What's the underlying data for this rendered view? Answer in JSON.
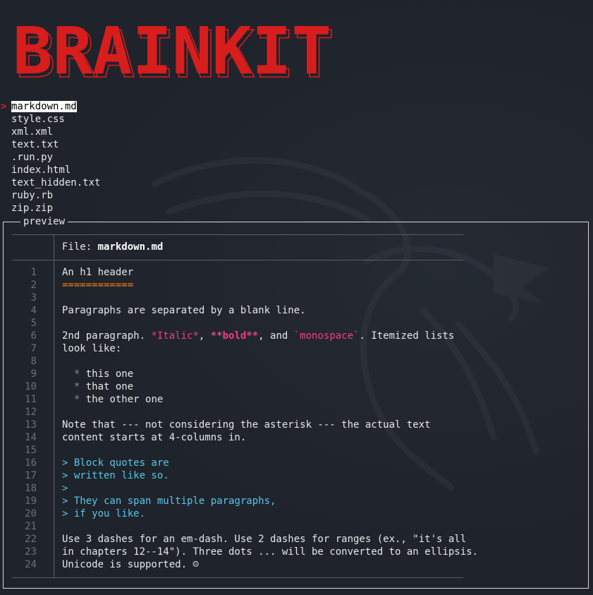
{
  "logo": {
    "text": "BRAINKIT",
    "color": "#d81d1d"
  },
  "files": {
    "pointer": ">",
    "items": [
      {
        "name": "markdown.md",
        "selected": true
      },
      {
        "name": "style.css"
      },
      {
        "name": "xml.xml"
      },
      {
        "name": "text.txt"
      },
      {
        "name": ".run.py"
      },
      {
        "name": "index.html"
      },
      {
        "name": "text_hidden.txt"
      },
      {
        "name": "ruby.rb"
      },
      {
        "name": "zip.zip"
      }
    ]
  },
  "preview": {
    "title": "preview",
    "file_label": "File:",
    "file_name": "markdown.md",
    "lines": [
      {
        "n": "1",
        "segs": [
          {
            "t": "An h1 header"
          }
        ]
      },
      {
        "n": "2",
        "segs": [
          {
            "t": "============",
            "c": "orange"
          }
        ]
      },
      {
        "n": "3",
        "segs": []
      },
      {
        "n": "4",
        "segs": [
          {
            "t": "Paragraphs are separated by a blank line."
          }
        ]
      },
      {
        "n": "5",
        "segs": []
      },
      {
        "n": "6",
        "segs": [
          {
            "t": "2nd paragraph. "
          },
          {
            "t": "*Italic*",
            "c": "pink"
          },
          {
            "t": ", "
          },
          {
            "t": "**bold**",
            "c": "pink bold"
          },
          {
            "t": ", and "
          },
          {
            "t": "`monospace`",
            "c": "pink"
          },
          {
            "t": ". Itemized lists"
          }
        ]
      },
      {
        "n": "7",
        "segs": [
          {
            "t": "look like:"
          }
        ]
      },
      {
        "n": "8",
        "segs": []
      },
      {
        "n": "9",
        "segs": [
          {
            "t": "  "
          },
          {
            "t": "*",
            "c": "grey"
          },
          {
            "t": " this one"
          }
        ]
      },
      {
        "n": "10",
        "segs": [
          {
            "t": "  "
          },
          {
            "t": "*",
            "c": "grey"
          },
          {
            "t": " that one"
          }
        ]
      },
      {
        "n": "11",
        "segs": [
          {
            "t": "  "
          },
          {
            "t": "*",
            "c": "grey"
          },
          {
            "t": " the other one"
          }
        ]
      },
      {
        "n": "12",
        "segs": []
      },
      {
        "n": "13",
        "segs": [
          {
            "t": "Note that --- not considering the asterisk --- the actual text"
          }
        ]
      },
      {
        "n": "14",
        "segs": [
          {
            "t": "content starts at 4-columns in."
          }
        ]
      },
      {
        "n": "15",
        "segs": []
      },
      {
        "n": "16",
        "segs": [
          {
            "t": "> Block quotes are",
            "c": "cyan"
          }
        ]
      },
      {
        "n": "17",
        "segs": [
          {
            "t": "> written like so.",
            "c": "cyan"
          }
        ]
      },
      {
        "n": "18",
        "segs": [
          {
            "t": ">",
            "c": "cyan"
          }
        ]
      },
      {
        "n": "19",
        "segs": [
          {
            "t": "> They can span multiple paragraphs,",
            "c": "cyan"
          }
        ]
      },
      {
        "n": "20",
        "segs": [
          {
            "t": "> if you like.",
            "c": "cyan"
          }
        ]
      },
      {
        "n": "21",
        "segs": []
      },
      {
        "n": "22",
        "segs": [
          {
            "t": "Use 3 dashes for an em-dash. Use 2 dashes for ranges (ex., \"it's all"
          }
        ]
      },
      {
        "n": "23",
        "segs": [
          {
            "t": "in chapters 12--14\"). Three dots ... will be converted to an ellipsis."
          }
        ]
      },
      {
        "n": "24",
        "segs": [
          {
            "t": "Unicode is supported. ☺"
          }
        ]
      }
    ]
  },
  "colors": {
    "background": "#1f232b",
    "logo_red": "#d81d1d",
    "pointer_red": "#e02020",
    "markdown_orange": "#f0841f",
    "markdown_pink": "#f53d7f",
    "quote_cyan": "#56c8e6"
  }
}
